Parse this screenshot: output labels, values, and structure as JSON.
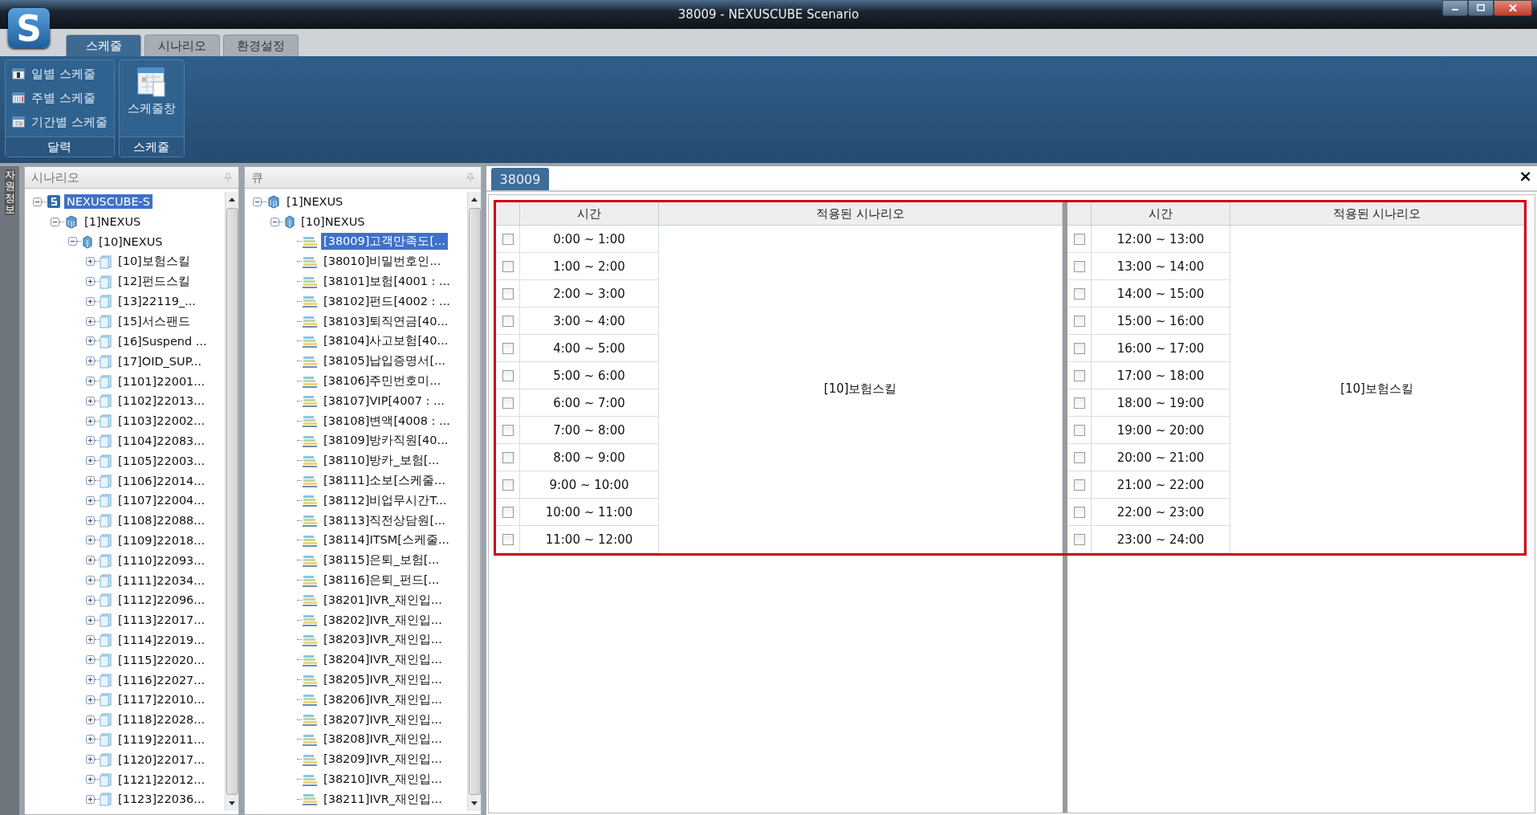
{
  "window": {
    "title": "38009 - NEXUSCUBE Scenario",
    "logo_text": "S"
  },
  "ribbon_tabs": [
    {
      "label": "스케줄",
      "selected": true
    },
    {
      "label": "시나리오",
      "selected": false
    },
    {
      "label": "환경설정",
      "selected": false
    }
  ],
  "ribbon_groups": [
    {
      "label": "달력",
      "items": [
        {
          "label": "일별 스케줄",
          "kind": "day"
        },
        {
          "label": "주별 스케줄",
          "kind": "week"
        },
        {
          "label": "기간별 스케줄",
          "kind": "period"
        }
      ]
    },
    {
      "label": "스케줄",
      "items": [
        {
          "label": "스케줄창",
          "kind": "large"
        }
      ]
    }
  ],
  "side_strip": {
    "label": "자원정보"
  },
  "scenario_panel": {
    "title": "시나리오",
    "tree": [
      {
        "label": "NEXUSCUBE-S",
        "kind": "root",
        "selected": true,
        "expanded": true,
        "children": [
          {
            "label": "[1]NEXUS",
            "kind": "server",
            "selected": false,
            "expanded": true,
            "children": [
              {
                "label": "[10]NEXUS",
                "kind": "group",
                "selected": false,
                "expanded": true,
                "children": [
                  {
                    "label": "[10]보험스킬",
                    "kind": "scenario",
                    "selected": false,
                    "expanded": false
                  },
                  {
                    "label": "[12]펀드스킬",
                    "kind": "scenario",
                    "selected": false,
                    "expanded": false
                  },
                  {
                    "label": "[13]22119_...",
                    "kind": "scenario",
                    "selected": false,
                    "expanded": false
                  },
                  {
                    "label": "[15]서스팬드",
                    "kind": "scenario",
                    "selected": false,
                    "expanded": false
                  },
                  {
                    "label": "[16]Suspend ...",
                    "kind": "scenario",
                    "selected": false,
                    "expanded": false
                  },
                  {
                    "label": "[17]OID_SUP...",
                    "kind": "scenario",
                    "selected": false,
                    "expanded": false
                  },
                  {
                    "label": "[1101]22001...",
                    "kind": "scenario",
                    "selected": false,
                    "expanded": false
                  },
                  {
                    "label": "[1102]22013...",
                    "kind": "scenario",
                    "selected": false,
                    "expanded": false
                  },
                  {
                    "label": "[1103]22002...",
                    "kind": "scenario",
                    "selected": false,
                    "expanded": false
                  },
                  {
                    "label": "[1104]22083...",
                    "kind": "scenario",
                    "selected": false,
                    "expanded": false
                  },
                  {
                    "label": "[1105]22003...",
                    "kind": "scenario",
                    "selected": false,
                    "expanded": false
                  },
                  {
                    "label": "[1106]22014...",
                    "kind": "scenario",
                    "selected": false,
                    "expanded": false
                  },
                  {
                    "label": "[1107]22004...",
                    "kind": "scenario",
                    "selected": false,
                    "expanded": false
                  },
                  {
                    "label": "[1108]22088...",
                    "kind": "scenario",
                    "selected": false,
                    "expanded": false
                  },
                  {
                    "label": "[1109]22018...",
                    "kind": "scenario",
                    "selected": false,
                    "expanded": false
                  },
                  {
                    "label": "[1110]22093...",
                    "kind": "scenario",
                    "selected": false,
                    "expanded": false
                  },
                  {
                    "label": "[1111]22034...",
                    "kind": "scenario",
                    "selected": false,
                    "expanded": false
                  },
                  {
                    "label": "[1112]22096...",
                    "kind": "scenario",
                    "selected": false,
                    "expanded": false
                  },
                  {
                    "label": "[1113]22017...",
                    "kind": "scenario",
                    "selected": false,
                    "expanded": false
                  },
                  {
                    "label": "[1114]22019...",
                    "kind": "scenario",
                    "selected": false,
                    "expanded": false
                  },
                  {
                    "label": "[1115]22020...",
                    "kind": "scenario",
                    "selected": false,
                    "expanded": false
                  },
                  {
                    "label": "[1116]22027...",
                    "kind": "scenario",
                    "selected": false,
                    "expanded": false
                  },
                  {
                    "label": "[1117]22010...",
                    "kind": "scenario",
                    "selected": false,
                    "expanded": false
                  },
                  {
                    "label": "[1118]22028...",
                    "kind": "scenario",
                    "selected": false,
                    "expanded": false
                  },
                  {
                    "label": "[1119]22011...",
                    "kind": "scenario",
                    "selected": false,
                    "expanded": false
                  },
                  {
                    "label": "[1120]22017...",
                    "kind": "scenario",
                    "selected": false,
                    "expanded": false
                  },
                  {
                    "label": "[1121]22012...",
                    "kind": "scenario",
                    "selected": false,
                    "expanded": false
                  },
                  {
                    "label": "[1123]22036...",
                    "kind": "scenario",
                    "selected": false,
                    "expanded": false
                  }
                ]
              }
            ]
          }
        ]
      }
    ]
  },
  "queue_panel": {
    "title": "큐",
    "tree": [
      {
        "label": "[1]NEXUS",
        "kind": "server",
        "selected": false,
        "expanded": true,
        "children": [
          {
            "label": "[10]NEXUS",
            "kind": "group",
            "selected": false,
            "expanded": true,
            "children": [
              {
                "label": "[38009]고객만족도[...",
                "kind": "queue",
                "selected": true
              },
              {
                "label": "[38010]비밀번호인...",
                "kind": "queue",
                "selected": false
              },
              {
                "label": "[38101]보험[4001 : ...",
                "kind": "queue",
                "selected": false
              },
              {
                "label": "[38102]펀드[4002 : ...",
                "kind": "queue",
                "selected": false
              },
              {
                "label": "[38103]퇴직연금[40...",
                "kind": "queue",
                "selected": false
              },
              {
                "label": "[38104]사고보험[40...",
                "kind": "queue",
                "selected": false
              },
              {
                "label": "[38105]납입증명서[...",
                "kind": "queue",
                "selected": false
              },
              {
                "label": "[38106]주민번호미...",
                "kind": "queue",
                "selected": false
              },
              {
                "label": "[38107]VIP[4007 : ...",
                "kind": "queue",
                "selected": false
              },
              {
                "label": "[38108]변액[4008 : ...",
                "kind": "queue",
                "selected": false
              },
              {
                "label": "[38109]방카직원[40...",
                "kind": "queue",
                "selected": false
              },
              {
                "label": "[38110]방카_보험[...",
                "kind": "queue",
                "selected": false
              },
              {
                "label": "[38111]소보[스케줄...",
                "kind": "queue",
                "selected": false
              },
              {
                "label": "[38112]비업무시간T...",
                "kind": "queue",
                "selected": false
              },
              {
                "label": "[38113]직전상담원[...",
                "kind": "queue",
                "selected": false
              },
              {
                "label": "[38114]ITSM[스케줄...",
                "kind": "queue",
                "selected": false
              },
              {
                "label": "[38115]은퇴_보험[...",
                "kind": "queue",
                "selected": false
              },
              {
                "label": "[38116]은퇴_펀드[...",
                "kind": "queue",
                "selected": false
              },
              {
                "label": "[38201]IVR_재인입...",
                "kind": "queue",
                "selected": false
              },
              {
                "label": "[38202]IVR_재인입...",
                "kind": "queue",
                "selected": false
              },
              {
                "label": "[38203]IVR_재인입...",
                "kind": "queue",
                "selected": false
              },
              {
                "label": "[38204]IVR_재인입...",
                "kind": "queue",
                "selected": false
              },
              {
                "label": "[38205]IVR_재인입...",
                "kind": "queue",
                "selected": false
              },
              {
                "label": "[38206]IVR_재인입...",
                "kind": "queue",
                "selected": false
              },
              {
                "label": "[38207]IVR_재인입...",
                "kind": "queue",
                "selected": false
              },
              {
                "label": "[38208]IVR_재인입...",
                "kind": "queue",
                "selected": false
              },
              {
                "label": "[38209]IVR_재인입...",
                "kind": "queue",
                "selected": false
              },
              {
                "label": "[38210]IVR_재인입...",
                "kind": "queue",
                "selected": false
              },
              {
                "label": "[38211]IVR_재인입...",
                "kind": "queue",
                "selected": false
              }
            ]
          }
        ]
      }
    ]
  },
  "document_tabs": [
    {
      "label": "38009",
      "selected": true
    }
  ],
  "close_label": "×",
  "schedule_tables": [
    {
      "columns": [
        "시간",
        "적용된 시나리오"
      ],
      "scenario": "[10]보험스킬",
      "rows": [
        {
          "time": "0:00 ~ 1:00",
          "checked": false
        },
        {
          "time": "1:00 ~ 2:00",
          "checked": false
        },
        {
          "time": "2:00 ~ 3:00",
          "checked": false
        },
        {
          "time": "3:00 ~ 4:00",
          "checked": false
        },
        {
          "time": "4:00 ~ 5:00",
          "checked": false
        },
        {
          "time": "5:00 ~ 6:00",
          "checked": false
        },
        {
          "time": "6:00 ~ 7:00",
          "checked": false
        },
        {
          "time": "7:00 ~ 8:00",
          "checked": false
        },
        {
          "time": "8:00 ~ 9:00",
          "checked": false
        },
        {
          "time": "9:00 ~ 10:00",
          "checked": false
        },
        {
          "time": "10:00 ~ 11:00",
          "checked": false
        },
        {
          "time": "11:00 ~ 12:00",
          "checked": false
        }
      ]
    },
    {
      "columns": [
        "시간",
        "적용된 시나리오"
      ],
      "scenario": "[10]보험스킬",
      "rows": [
        {
          "time": "12:00 ~ 13:00",
          "checked": false
        },
        {
          "time": "13:00 ~ 14:00",
          "checked": false
        },
        {
          "time": "14:00 ~ 15:00",
          "checked": false
        },
        {
          "time": "15:00 ~ 16:00",
          "checked": false
        },
        {
          "time": "16:00 ~ 17:00",
          "checked": false
        },
        {
          "time": "17:00 ~ 18:00",
          "checked": false
        },
        {
          "time": "18:00 ~ 19:00",
          "checked": false
        },
        {
          "time": "19:00 ~ 20:00",
          "checked": false
        },
        {
          "time": "20:00 ~ 21:00",
          "checked": false
        },
        {
          "time": "21:00 ~ 22:00",
          "checked": false
        },
        {
          "time": "22:00 ~ 23:00",
          "checked": false
        },
        {
          "time": "23:00 ~ 24:00",
          "checked": false
        }
      ]
    }
  ]
}
